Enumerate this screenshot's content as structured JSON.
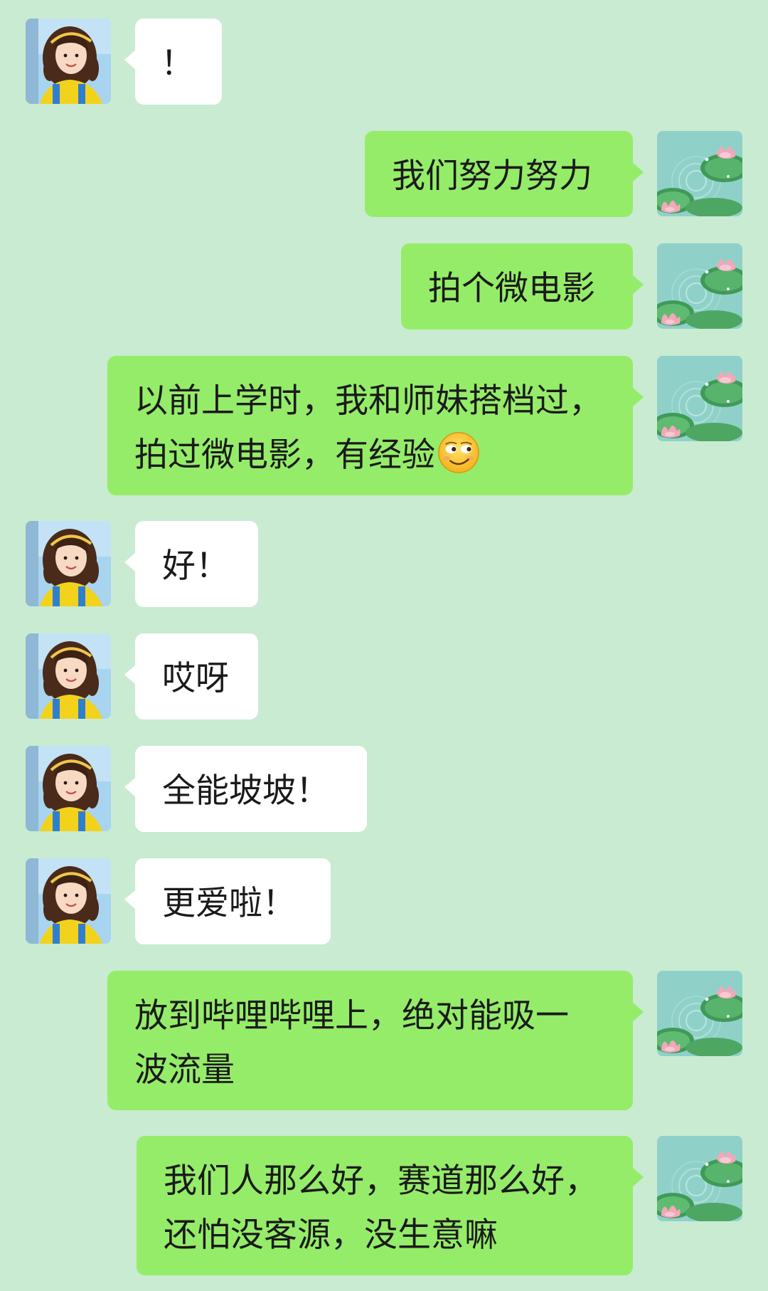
{
  "messages": [
    {
      "side": "in",
      "lines": [
        "！"
      ]
    },
    {
      "side": "out",
      "lines": [
        "我们努力努力"
      ]
    },
    {
      "side": "out",
      "lines": [
        "拍个微电影"
      ]
    },
    {
      "side": "out",
      "lines": [
        "以前上学时，我和师妹搭档过，",
        "拍过微电影，有经验"
      ],
      "emoji": "smirk-face-emoji"
    },
    {
      "side": "in",
      "lines": [
        "好！"
      ]
    },
    {
      "side": "in",
      "lines": [
        "哎呀"
      ]
    },
    {
      "side": "in",
      "lines": [
        "全能坡坡！"
      ]
    },
    {
      "side": "in",
      "lines": [
        "更爱啦！"
      ]
    },
    {
      "side": "out",
      "lines": [
        "放到哔哩哔哩上，绝对能吸一",
        "波流量"
      ]
    },
    {
      "side": "out",
      "lines": [
        "我们人那么好，赛道那么好，",
        "还怕没客源，没生意嘛"
      ]
    }
  ],
  "theme": {
    "background": "#c9ebd1",
    "incoming_bubble": "#ffffff",
    "outgoing_bubble": "#95ec69"
  }
}
